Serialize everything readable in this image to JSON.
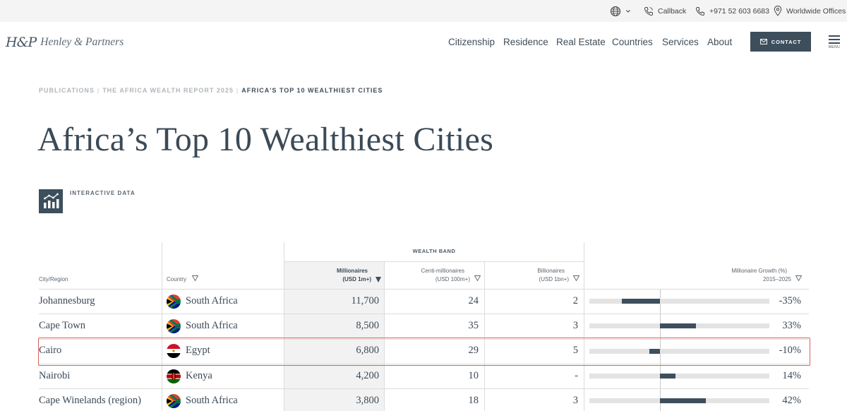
{
  "topbar": {
    "callback_label": "Callback",
    "phone_label": "+971 52 603 6683",
    "offices_label": "Worldwide Offices"
  },
  "header": {
    "logo_mark": "H&P",
    "logo_text": "Henley & Partners",
    "nav": [
      "Citizenship",
      "Residence",
      "Real Estate",
      "Countries",
      "Services",
      "About"
    ],
    "contact_label": "CONTACT",
    "menu_label": "MENU"
  },
  "breadcrumb": {
    "items": [
      "PUBLICATIONS",
      "THE AFRICA WEALTH REPORT 2025",
      "AFRICA'S TOP 10 WEALTHIEST CITIES"
    ],
    "separator": "|"
  },
  "page": {
    "title": "Africa’s Top 10 Wealthiest Cities",
    "interactive_label": "INTERACTIVE DATA"
  },
  "table": {
    "band_label": "WEALTH BAND",
    "headers": {
      "city": "City/Region",
      "country": "Country",
      "millionaires_1": "Millionaires",
      "millionaires_2": "(USD 1m+)",
      "centi_1": "Centi-millionaires",
      "centi_2": "(USD 100m+)",
      "billionaires_1": "Billionaires",
      "billionaires_2": "(USD 1bn+)",
      "growth_1": "Millionaire Growth (%)",
      "growth_2": "2015–2025"
    },
    "growth_scale_max": 100,
    "rows": [
      {
        "city": "Johannesburg",
        "country": "South Africa",
        "flag": "south-africa",
        "millionaires": "11,700",
        "centi": "24",
        "billionaires": "2",
        "growth_label": "-35%",
        "growth": -35
      },
      {
        "city": "Cape Town",
        "country": "South Africa",
        "flag": "south-africa",
        "millionaires": "8,500",
        "centi": "35",
        "billionaires": "3",
        "growth_label": "33%",
        "growth": 33
      },
      {
        "city": "Cairo",
        "country": "Egypt",
        "flag": "egypt",
        "millionaires": "6,800",
        "centi": "29",
        "billionaires": "5",
        "growth_label": "-10%",
        "growth": -10
      },
      {
        "city": "Nairobi",
        "country": "Kenya",
        "flag": "kenya",
        "millionaires": "4,200",
        "centi": "10",
        "billionaires": "-",
        "growth_label": "14%",
        "growth": 14
      },
      {
        "city": "Cape Winelands (region)",
        "country": "South Africa",
        "flag": "south-africa",
        "millionaires": "3,800",
        "centi": "18",
        "billionaires": "3",
        "growth_label": "42%",
        "growth": 42
      }
    ]
  },
  "colors": {
    "accent": "#3d4e5c",
    "highlight": "#e06060",
    "track": "#e3e3e3"
  }
}
